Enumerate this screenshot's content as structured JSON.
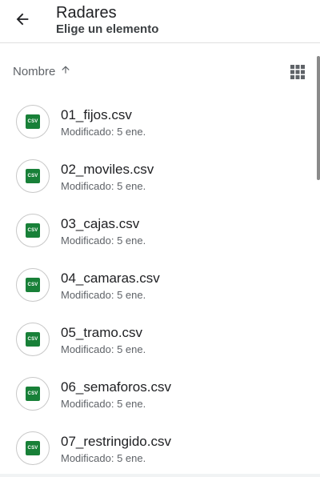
{
  "header": {
    "title": "Radares",
    "subtitle": "Elige un elemento",
    "back_icon": "arrow-back-icon"
  },
  "sort": {
    "label": "Nombre",
    "direction_icon": "arrow-up-icon",
    "view_icon": "grid-view-icon"
  },
  "files": [
    {
      "name": "01_fijos.csv",
      "meta": "Modificado: 5 ene.",
      "icon_label": "CSV"
    },
    {
      "name": "02_moviles.csv",
      "meta": "Modificado: 5 ene.",
      "icon_label": "CSV"
    },
    {
      "name": "03_cajas.csv",
      "meta": "Modificado: 5 ene.",
      "icon_label": "CSV"
    },
    {
      "name": "04_camaras.csv",
      "meta": "Modificado: 5 ene.",
      "icon_label": "CSV"
    },
    {
      "name": "05_tramo.csv",
      "meta": "Modificado: 5 ene.",
      "icon_label": "CSV"
    },
    {
      "name": "06_semaforos.csv",
      "meta": "Modificado: 5 ene.",
      "icon_label": "CSV"
    },
    {
      "name": "07_restringido.csv",
      "meta": "Modificado: 5 ene.",
      "icon_label": "CSV"
    }
  ],
  "colors": {
    "csv_green": "#188038",
    "text_primary": "#202124",
    "text_secondary": "#5f6368"
  }
}
